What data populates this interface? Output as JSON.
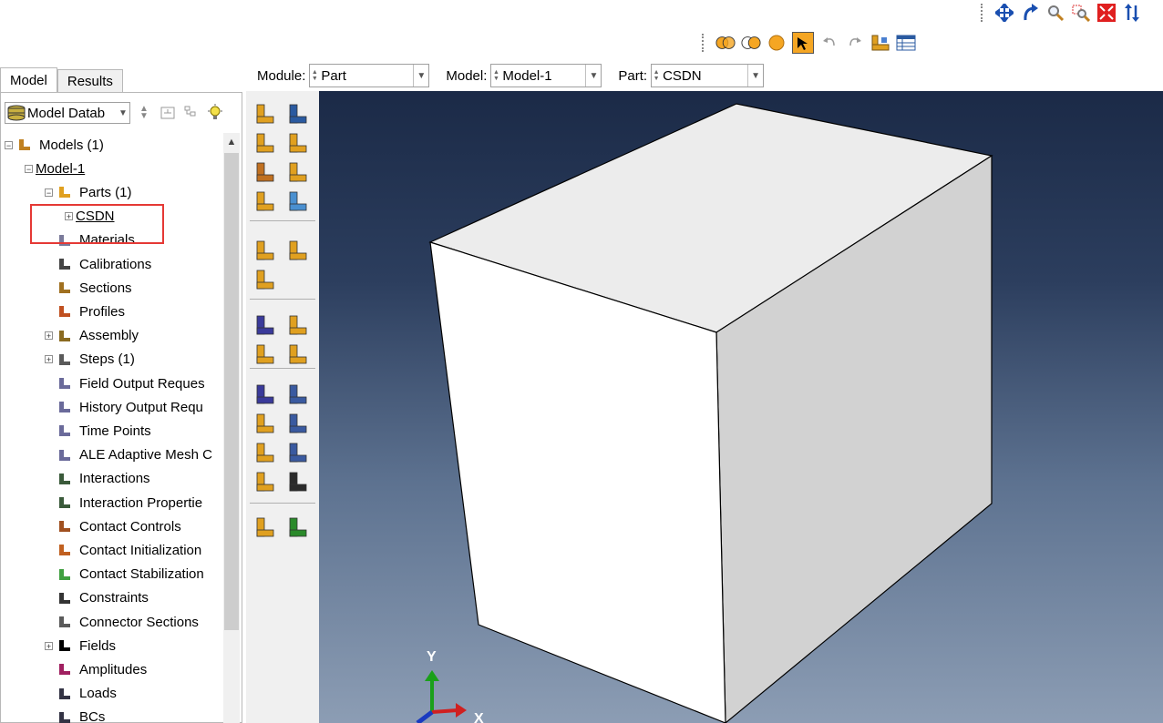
{
  "toolbars": {
    "view": [
      "pan-icon",
      "rotate-icon",
      "magnify-icon",
      "zoom-box-icon",
      "auto-fit-icon",
      "cycle-views-icon"
    ],
    "render": [
      "assembly-display-icon",
      "part-display-icon",
      "render-sphere-icon",
      "select-icon",
      "undo-icon",
      "redo-icon",
      "part-manager-icon",
      "table-icon"
    ]
  },
  "context": {
    "module_label": "Module:",
    "module_value": "Part",
    "model_label": "Model:",
    "model_value": "Model-1",
    "part_label": "Part:",
    "part_value": "CSDN"
  },
  "tabs": {
    "model": "Model",
    "results": "Results"
  },
  "tree_toolbar": {
    "db_label": "Model Datab"
  },
  "tree": [
    {
      "label": "Models (1)",
      "expander": "⊟",
      "icon": "models-icon"
    },
    {
      "label": "Model-1",
      "expander": "⊟",
      "icon": ""
    },
    {
      "label": "Parts (1)",
      "expander": "⊟",
      "icon": "parts-icon"
    },
    {
      "label": "CSDN",
      "expander": "⊞",
      "icon": ""
    },
    {
      "label": "Materials",
      "expander": "",
      "icon": "materials-icon"
    },
    {
      "label": "Calibrations",
      "expander": "",
      "icon": "calibrations-icon"
    },
    {
      "label": "Sections",
      "expander": "",
      "icon": "sections-icon"
    },
    {
      "label": "Profiles",
      "expander": "",
      "icon": "profiles-icon"
    },
    {
      "label": "Assembly",
      "expander": "⊞",
      "icon": "assembly-icon"
    },
    {
      "label": "Steps (1)",
      "expander": "⊞",
      "icon": "steps-icon"
    },
    {
      "label": "Field Output Reques",
      "expander": "",
      "icon": "field-output-icon"
    },
    {
      "label": "History Output Requ",
      "expander": "",
      "icon": "history-output-icon"
    },
    {
      "label": "Time Points",
      "expander": "",
      "icon": "time-points-icon"
    },
    {
      "label": "ALE Adaptive Mesh C",
      "expander": "",
      "icon": "ale-mesh-icon"
    },
    {
      "label": "Interactions",
      "expander": "",
      "icon": "interactions-icon"
    },
    {
      "label": "Interaction Propertie",
      "expander": "",
      "icon": "interaction-properties-icon"
    },
    {
      "label": "Contact Controls",
      "expander": "",
      "icon": "contact-controls-icon"
    },
    {
      "label": "Contact Initialization",
      "expander": "",
      "icon": "contact-initialization-icon"
    },
    {
      "label": "Contact Stabilization",
      "expander": "",
      "icon": "contact-stabilization-icon"
    },
    {
      "label": "Constraints",
      "expander": "",
      "icon": "constraints-icon"
    },
    {
      "label": "Connector Sections",
      "expander": "",
      "icon": "connector-sections-icon"
    },
    {
      "label": "Fields",
      "expander": "⊞",
      "icon": "fields-icon"
    },
    {
      "label": "Amplitudes",
      "expander": "",
      "icon": "amplitudes-icon"
    },
    {
      "label": "Loads",
      "expander": "",
      "icon": "loads-icon"
    },
    {
      "label": "BCs",
      "expander": "",
      "icon": "bcs-icon"
    }
  ],
  "toolbox_icons": [
    "create-part-icon",
    "part-manager-icon",
    "extrude-solid-icon",
    "revolve-solid-icon",
    "cut-extrude-icon",
    "shell-icon",
    "solid-icon",
    "blend-icon",
    "partition-cell-icon",
    "partition-face-icon",
    "virtual-topology-icon",
    "query-icon",
    "create-datum-icon",
    "datum-point-icon",
    "datum-axis-icon",
    "xyz-datum-icon",
    "datum-csys-icon",
    "datum-plane-icon",
    "csys-icon",
    "repair-icon",
    "wire-icon",
    "sketch-icon",
    "tools-icon",
    "partition-icon",
    "mirror-icon"
  ],
  "triad": {
    "y": "Y",
    "x": "X"
  },
  "colors": {
    "viewport_top": "#1b2a47",
    "viewport_bottom": "#8c9db4",
    "highlight": "#e53935",
    "part_face_front": "#ffffff",
    "part_face_top": "#ececec",
    "part_face_right": "#d2d2d2"
  }
}
